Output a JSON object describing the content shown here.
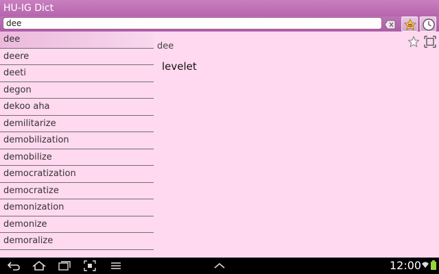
{
  "app": {
    "title": "HU-IG Dict"
  },
  "search": {
    "value": "dee"
  },
  "words": [
    "dee",
    "deere",
    "deeti",
    "degon",
    "dekoo aha",
    "demilitarize",
    "demobilization",
    "demobilize",
    "democratization",
    "democratize",
    "demonization",
    "demonize",
    "demoralize"
  ],
  "selected_index": 0,
  "detail": {
    "word": "dee",
    "meaning": "levelet"
  },
  "status": {
    "time": "12:00"
  },
  "colors": {
    "accent": "#b565ad",
    "background": "#ffd9f0",
    "navbar": "#000000"
  }
}
